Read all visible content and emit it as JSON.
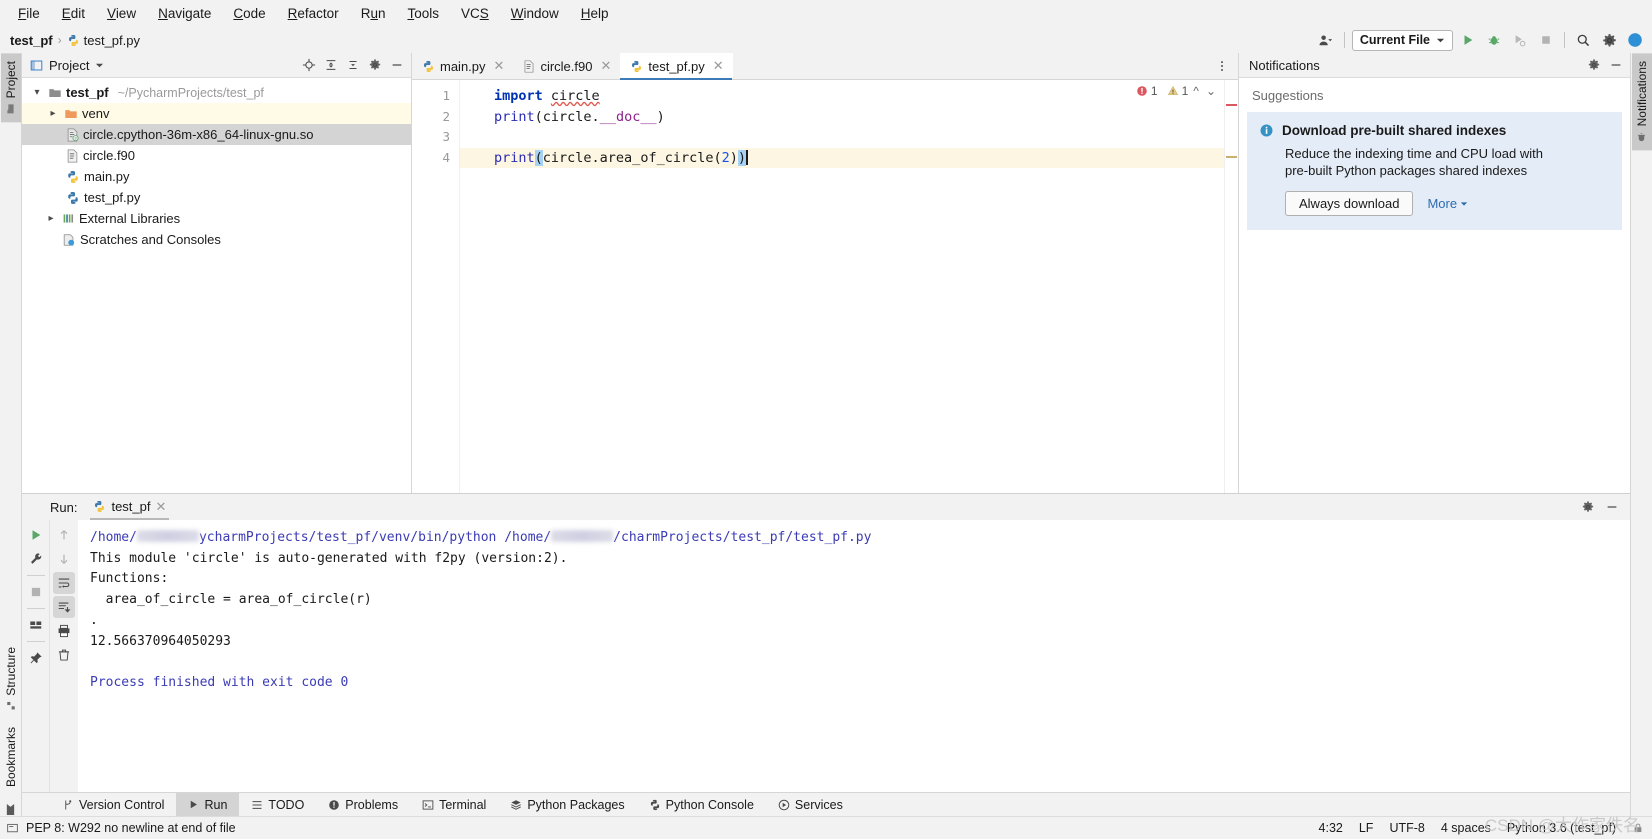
{
  "menu": {
    "items": [
      {
        "label": "File",
        "mnemonic": "F"
      },
      {
        "label": "Edit",
        "mnemonic": "E"
      },
      {
        "label": "View",
        "mnemonic": "V"
      },
      {
        "label": "Navigate",
        "mnemonic": "N"
      },
      {
        "label": "Code",
        "mnemonic": "C"
      },
      {
        "label": "Refactor",
        "mnemonic": "R"
      },
      {
        "label": "Run",
        "mnemonic": "u"
      },
      {
        "label": "Tools",
        "mnemonic": "T"
      },
      {
        "label": "VCS",
        "mnemonic": "S"
      },
      {
        "label": "Window",
        "mnemonic": "W"
      },
      {
        "label": "Help",
        "mnemonic": "H"
      }
    ]
  },
  "breadcrumb": {
    "project": "test_pf",
    "separator": "›",
    "file": "test_pf.py"
  },
  "toolbar": {
    "account_icon": "person-icon",
    "run_config": "Current File",
    "run_icon": "run-icon",
    "debug_icon": "debug-icon",
    "coverage_icon": "coverage-icon",
    "stop_icon": "stop-icon",
    "search_icon": "search-icon",
    "settings_icon": "gear-icon",
    "ai_icon": "ai-assistant-icon"
  },
  "left_rail": {
    "tabs": [
      {
        "label": "Project",
        "icon": "project-folder-icon",
        "active": true
      }
    ],
    "bottom_tabs": [
      {
        "label": "Structure",
        "icon": "structure-icon"
      },
      {
        "label": "Bookmarks",
        "icon": "bookmark-icon"
      }
    ]
  },
  "right_rail": {
    "tabs": [
      {
        "label": "Notifications",
        "icon": "notifications-icon",
        "active": true
      }
    ]
  },
  "project_panel": {
    "title": "Project",
    "dropdown_icon": "chevron-down-icon",
    "header_icons": [
      "locate-icon",
      "expand-all-icon",
      "collapse-all-icon",
      "gear-icon",
      "hide-icon"
    ],
    "tree": [
      {
        "label": "test_pf",
        "path": "~/PycharmProjects/test_pf",
        "icon": "folder-icon",
        "arrow": "expanded",
        "indent": 0,
        "bold": true,
        "highlight": "none"
      },
      {
        "label": "venv",
        "path": "",
        "icon": "folder-orange-icon",
        "arrow": "collapsed",
        "indent": 1,
        "bold": false,
        "highlight": "yellow"
      },
      {
        "label": "circle.cpython-36m-x86_64-linux-gnu.so",
        "path": "",
        "icon": "binary-file-icon",
        "arrow": "none",
        "indent": 2,
        "bold": false,
        "highlight": "grey"
      },
      {
        "label": "circle.f90",
        "path": "",
        "icon": "text-file-icon",
        "arrow": "none",
        "indent": 2,
        "bold": false,
        "highlight": "none"
      },
      {
        "label": "main.py",
        "path": "",
        "icon": "python-file-icon",
        "arrow": "none",
        "indent": 2,
        "bold": false,
        "highlight": "none"
      },
      {
        "label": "test_pf.py",
        "path": "",
        "icon": "python-file-icon",
        "arrow": "none",
        "indent": 2,
        "bold": false,
        "highlight": "none"
      },
      {
        "label": "External Libraries",
        "path": "",
        "icon": "library-icon",
        "arrow": "collapsed",
        "indent": 0,
        "bold": false,
        "highlight": "none"
      },
      {
        "label": "Scratches and Consoles",
        "path": "",
        "icon": "scratches-icon",
        "arrow": "none",
        "indent": 1,
        "bold": false,
        "highlight": "none"
      }
    ]
  },
  "editor": {
    "tabs": [
      {
        "label": "main.py",
        "icon": "python-file-icon",
        "active": false
      },
      {
        "label": "circle.f90",
        "icon": "text-file-icon",
        "active": false
      },
      {
        "label": "test_pf.py",
        "icon": "python-file-icon",
        "active": true
      }
    ],
    "more_icon": "more-vertical-icon",
    "inspection": {
      "error_count": "1",
      "warning_count": "1",
      "error_icon": "error-circle-icon",
      "warning_icon": "warning-triangle-icon",
      "prev_icon": "chevron-up-icon",
      "next_icon": "chevron-down-icon"
    },
    "line_numbers": [
      "1",
      "2",
      "3",
      "4"
    ],
    "code": {
      "line1": {
        "keyword": "import",
        "module": "circle"
      },
      "line2": {
        "fn": "print",
        "open": "(",
        "obj": "circle.",
        "attr": "__doc__",
        "close": ")"
      },
      "line3": "",
      "line4": {
        "fn": "print",
        "open": "(",
        "expr": "circle.area_of_circle(",
        "arg": "2",
        "close1": ")",
        "close2": ")"
      }
    }
  },
  "notifications": {
    "title": "Notifications",
    "gear_icon": "gear-icon",
    "hide_icon": "hide-icon",
    "section": "Suggestions",
    "card": {
      "info_icon": "info-icon",
      "title": "Download pre-built shared indexes",
      "text_line1": "Reduce the indexing time and CPU load with",
      "text_line2": "pre-built Python packages shared indexes",
      "primary_button": "Always download",
      "more_link": "More",
      "more_icon": "chevron-down-icon",
      "background": "#e4ecf7"
    }
  },
  "run_panel": {
    "label": "Run:",
    "tab": {
      "label": "test_pf",
      "icon": "python-file-icon",
      "close_icon": "close-icon"
    },
    "header_icons": [
      "gear-icon",
      "hide-icon"
    ],
    "tools_left": [
      "rerun-icon",
      "settings-wrench-icon",
      "stop-icon",
      "layout-icon",
      "pin-icon"
    ],
    "tools_right": [
      "up-arrow-icon",
      "down-arrow-icon",
      "soft-wrap-icon",
      "scroll-to-end-icon",
      "print-icon",
      "trash-icon"
    ],
    "console": [
      {
        "type": "path",
        "prefix": "/home/",
        "blurred": true,
        "suffix": "ycharmProjects/test_pf/venv/bin/python /home/",
        "blurred2": true,
        "suffix2": "/charmProjects/test_pf/test_pf.py"
      },
      {
        "type": "out",
        "text": "This module 'circle' is auto-generated with f2py (version:2)."
      },
      {
        "type": "out",
        "text": "Functions:"
      },
      {
        "type": "out",
        "text": "  area_of_circle = area_of_circle(r)"
      },
      {
        "type": "out",
        "text": "."
      },
      {
        "type": "out",
        "text": "12.566370964050293"
      },
      {
        "type": "blank",
        "text": ""
      },
      {
        "type": "finish",
        "text": "Process finished with exit code 0"
      }
    ]
  },
  "bottom_tabs": [
    {
      "label": "Version Control",
      "icon": "branch-icon",
      "active": false
    },
    {
      "label": "Run",
      "icon": "run-icon",
      "active": true
    },
    {
      "label": "TODO",
      "icon": "todo-icon",
      "active": false
    },
    {
      "label": "Problems",
      "icon": "problems-icon",
      "active": false
    },
    {
      "label": "Terminal",
      "icon": "terminal-icon",
      "active": false
    },
    {
      "label": "Python Packages",
      "icon": "packages-icon",
      "active": false
    },
    {
      "label": "Python Console",
      "icon": "python-console-icon",
      "active": false
    },
    {
      "label": "Services",
      "icon": "services-icon",
      "active": false
    }
  ],
  "statusbar": {
    "message_icon": "message-icon",
    "message": "PEP 8: W292 no newline at end of file",
    "caret_position": "4:32",
    "line_separator": "LF",
    "encoding": "UTF-8",
    "indent": "4 spaces",
    "interpreter": "Python 3.6 (test_pf)",
    "lock_icon": "lock-icon",
    "watermark": "CSDN @大作家佚名"
  }
}
